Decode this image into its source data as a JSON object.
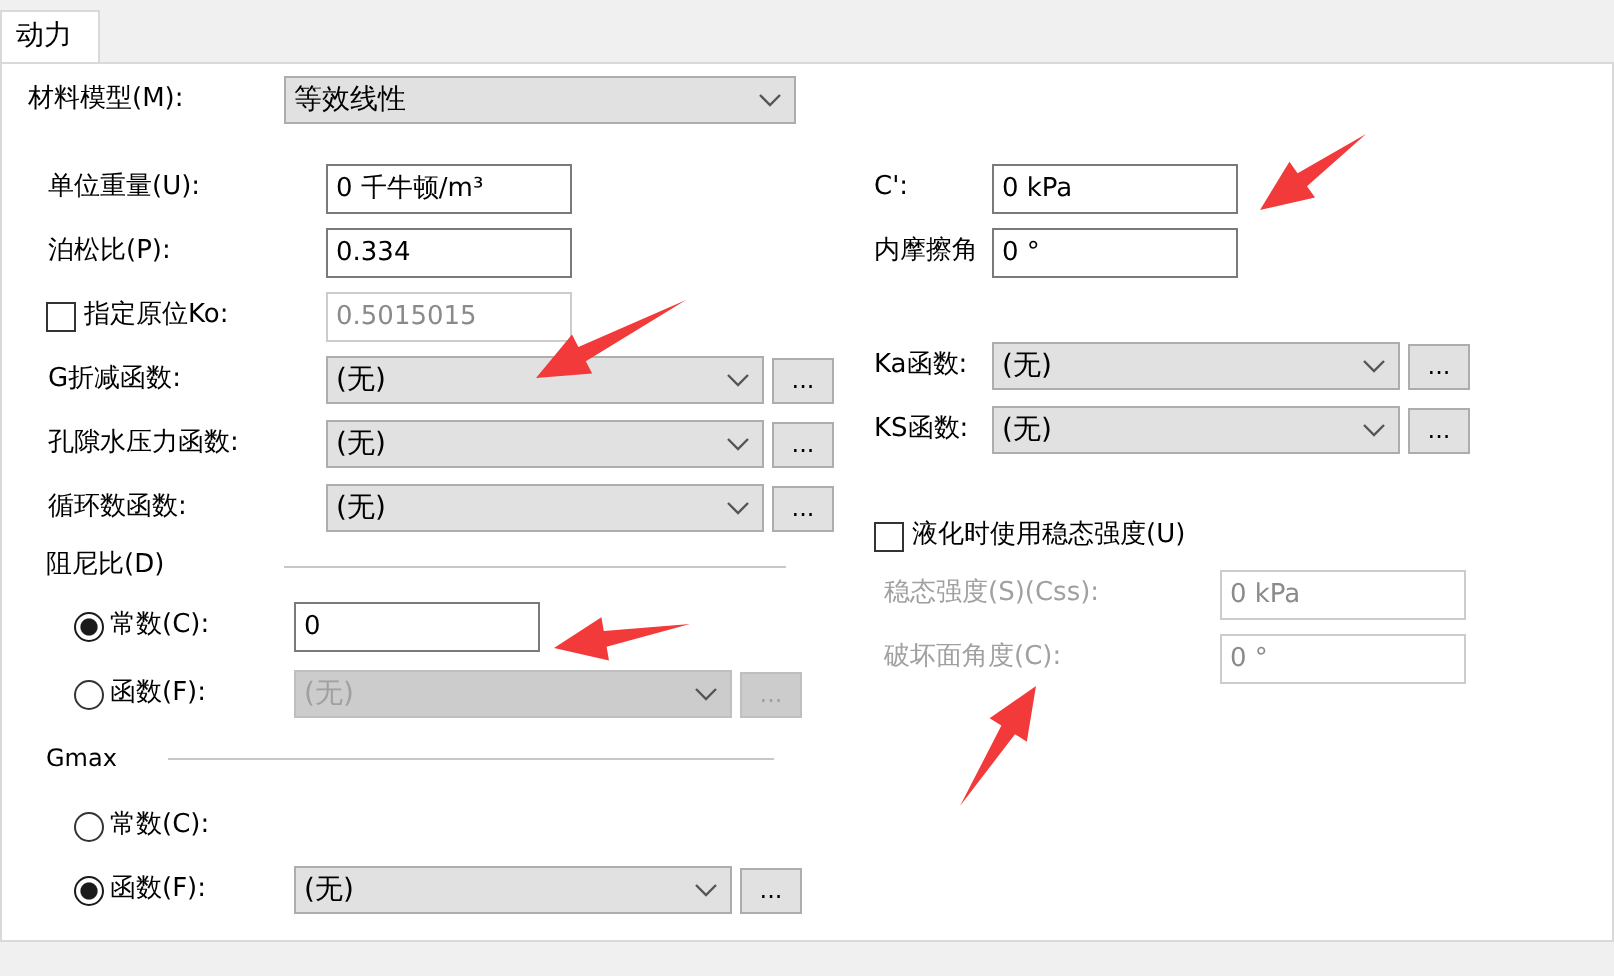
{
  "tabs": [
    {
      "label": "动力",
      "selected": true
    }
  ],
  "material_model": {
    "label": "材料模型(M):",
    "value": "等效线性"
  },
  "left_fields": [
    {
      "kind": "text",
      "label": "单位重量(U):",
      "value": "0 千牛顿/m³"
    },
    {
      "kind": "text",
      "label": "泊松比(P):",
      "value": "0.334"
    },
    {
      "kind": "checkbox_text",
      "label": "指定原位Ko:",
      "checked": false,
      "value": "0.5015015",
      "disabled": true
    },
    {
      "kind": "select",
      "label": "G折减函数:",
      "value": "(无)",
      "button": "..."
    },
    {
      "kind": "select",
      "label": "孔隙水压力函数:",
      "value": "(无)",
      "button": "..."
    },
    {
      "kind": "select",
      "label": "循环数函数:",
      "value": "(无)",
      "button": "..."
    }
  ],
  "strength_fields": [
    {
      "label": "C':",
      "value": "0 kPa"
    },
    {
      "label": "内摩擦角",
      "value": "0 °"
    }
  ],
  "right_functions": [
    {
      "label": "Ka函数:",
      "value": "(无)",
      "button": "..."
    },
    {
      "label": "KS函数:",
      "value": "(无)",
      "button": "..."
    }
  ],
  "damping": {
    "title": "阻尼比(D)",
    "options": [
      {
        "kind": "constant",
        "label": "常数(C):",
        "selected": true,
        "value": "0",
        "disabled": false
      },
      {
        "kind": "function",
        "label": "函数(F):",
        "selected": false,
        "value": "(无)",
        "button": "...",
        "disabled": true
      }
    ]
  },
  "gmax": {
    "title": "Gmax",
    "options": [
      {
        "kind": "constant",
        "label": "常数(C):",
        "selected": false
      },
      {
        "kind": "function",
        "label": "函数(F):",
        "selected": true,
        "value": "(无)",
        "button": "...",
        "disabled": false
      }
    ]
  },
  "liquefaction": {
    "label": "液化时使用稳态强度(U)",
    "checked": false,
    "fields": [
      {
        "label": "稳态强度(S)(Css):",
        "value": "0 kPa",
        "disabled": true
      },
      {
        "label": "破坏面角度(C):",
        "value": "0 °",
        "disabled": true
      }
    ]
  }
}
